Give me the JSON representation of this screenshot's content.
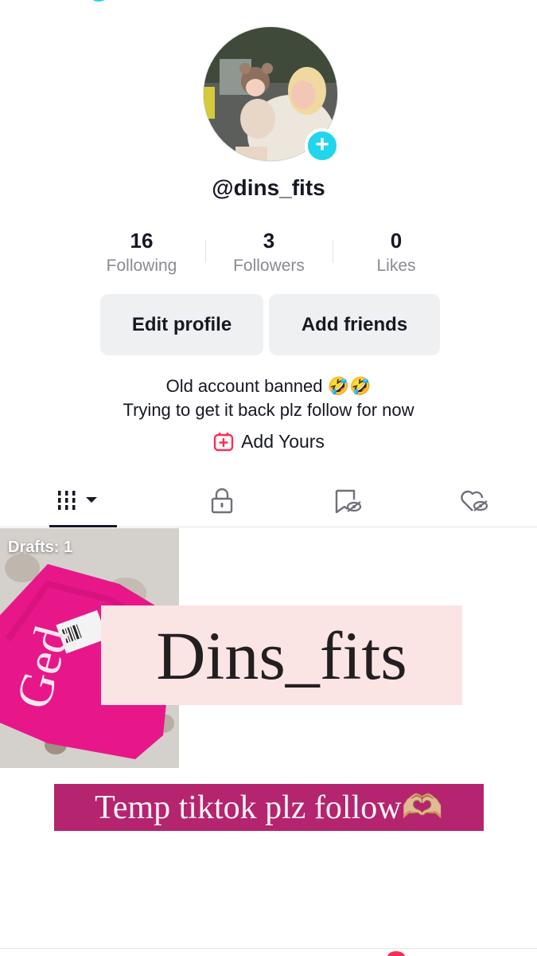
{
  "profile": {
    "username": "@dins_fits",
    "avatar_icon": "profile-photo",
    "add_icon": "plus-icon"
  },
  "stats": [
    {
      "value": "16",
      "label": "Following"
    },
    {
      "value": "3",
      "label": "Followers"
    },
    {
      "value": "0",
      "label": "Likes"
    }
  ],
  "buttons": {
    "edit_profile": "Edit profile",
    "add_friends": "Add friends"
  },
  "bio": {
    "line1": "Old account banned 🤣🤣",
    "line2": "Trying to get it back plz follow for now"
  },
  "add_yours": {
    "label": "Add Yours",
    "icon": "add-yours-icon"
  },
  "tabs": [
    {
      "icon": "grid-icon",
      "active": true
    },
    {
      "icon": "lock-icon",
      "active": false
    },
    {
      "icon": "bookmark-hidden-icon",
      "active": false
    },
    {
      "icon": "heart-hidden-icon",
      "active": false
    }
  ],
  "content": {
    "drafts_label": "Drafts: 1",
    "banner_name": "Dins_fits",
    "banner_temp": "Temp tiktok plz follow🫶🏼"
  },
  "colors": {
    "accent_cyan": "#20d5ec",
    "tiktok_red": "#fe2c55",
    "text_primary": "#161823",
    "text_secondary": "#8a8b91",
    "button_bg": "#eff0f2",
    "banner_pink": "#fbe4e4",
    "banner_magenta": "#b5246e"
  }
}
